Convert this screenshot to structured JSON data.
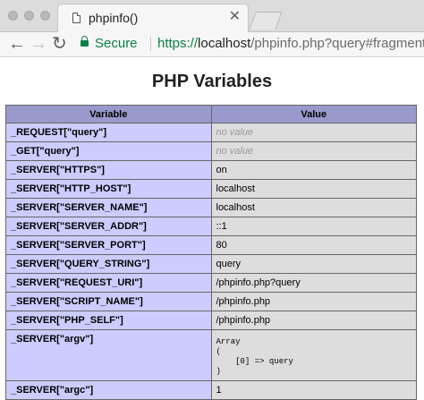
{
  "browser": {
    "tab_title": "phpinfo()",
    "close_glyph": "✕",
    "back_glyph": "←",
    "forward_glyph": "→",
    "reload_glyph": "↻",
    "secure_label": "Secure",
    "url_scheme": "https://",
    "url_host": "localhost",
    "url_rest": "/phpinfo.php?query#fragment",
    "secure_color": "#0b8043"
  },
  "page": {
    "title": "PHP Variables",
    "headers": [
      "Variable",
      "Value"
    ],
    "rows": [
      {
        "name": "_REQUEST[\"query\"]",
        "value": "no value",
        "novalue": true
      },
      {
        "name": "_GET[\"query\"]",
        "value": "no value",
        "novalue": true
      },
      {
        "name": "_SERVER[\"HTTPS\"]",
        "value": "on"
      },
      {
        "name": "_SERVER[\"HTTP_HOST\"]",
        "value": "localhost"
      },
      {
        "name": "_SERVER[\"SERVER_NAME\"]",
        "value": "localhost"
      },
      {
        "name": "_SERVER[\"SERVER_ADDR\"]",
        "value": "::1"
      },
      {
        "name": "_SERVER[\"SERVER_PORT\"]",
        "value": "80"
      },
      {
        "name": "_SERVER[\"QUERY_STRING\"]",
        "value": "query"
      },
      {
        "name": "_SERVER[\"REQUEST_URI\"]",
        "value": "/phpinfo.php?query"
      },
      {
        "name": "_SERVER[\"SCRIPT_NAME\"]",
        "value": "/phpinfo.php"
      },
      {
        "name": "_SERVER[\"PHP_SELF\"]",
        "value": "/phpinfo.php"
      },
      {
        "name": "_SERVER[\"argv\"]",
        "value": "Array\n(\n    [0] => query\n)",
        "pre": true
      },
      {
        "name": "_SERVER[\"argc\"]",
        "value": "1"
      }
    ],
    "header_color": "#9999cc",
    "name_cell_color": "#ccccff",
    "value_cell_color": "#dddddd"
  }
}
